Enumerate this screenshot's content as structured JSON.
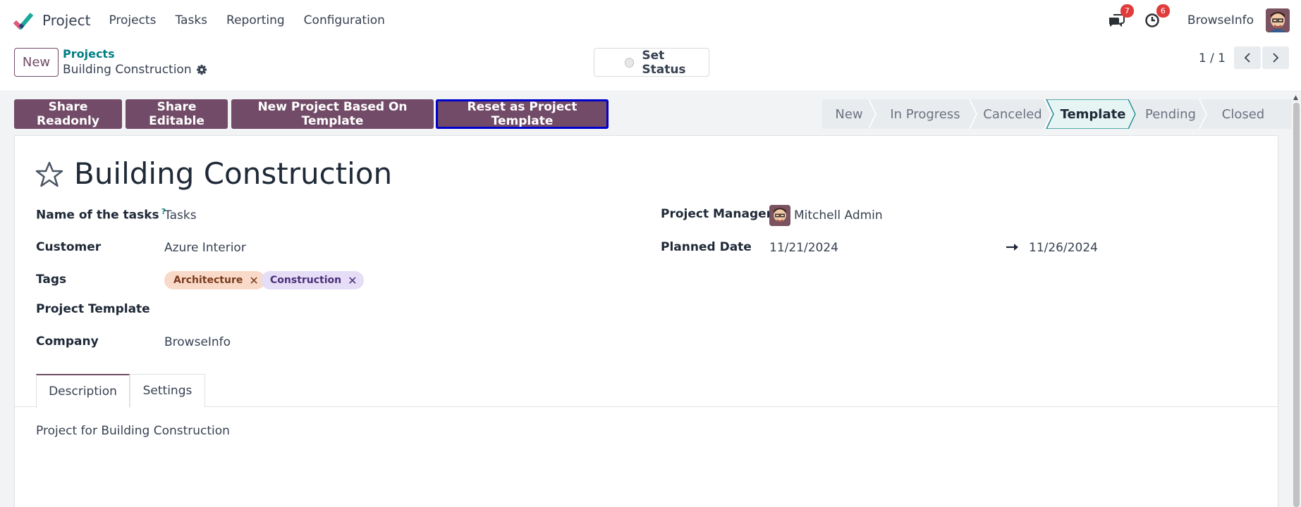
{
  "navbar": {
    "app_name": "Project",
    "menu": [
      "Projects",
      "Tasks",
      "Reporting",
      "Configuration"
    ],
    "messages_count": "7",
    "activities_count": "6",
    "company": "BrowseInfo"
  },
  "control_panel": {
    "new_label": "New",
    "breadcrumb_parent": "Projects",
    "breadcrumb_current": "Building Construction",
    "set_status_label": "Set Status",
    "pager": "1 / 1"
  },
  "actions": {
    "share_readonly": "Share Readonly",
    "share_editable": "Share Editable",
    "new_based_on_template": "New Project Based On Template",
    "reset_template": "Reset as Project Template"
  },
  "stages": [
    "New",
    "In Progress",
    "Canceled",
    "Template",
    "Pending",
    "Closed"
  ],
  "active_stage": "Template",
  "form": {
    "title": "Building Construction",
    "fields": {
      "tasks_label": "Name of the tasks",
      "tasks_help": "?",
      "tasks_value": "Tasks",
      "customer_label": "Customer",
      "customer_value": "Azure Interior",
      "tags_label": "Tags",
      "tags": [
        "Architecture",
        "Construction"
      ],
      "template_label": "Project Template",
      "company_label": "Company",
      "company_value": "BrowseInfo",
      "manager_label": "Project Manager",
      "manager_value": "Mitchell Admin",
      "planned_label": "Planned Date",
      "planned_start": "11/21/2024",
      "planned_end": "11/26/2024"
    },
    "tabs": [
      "Description",
      "Settings"
    ],
    "active_tab": "Description",
    "description": "Project for Building Construction"
  },
  "colors": {
    "primary": "#714b67",
    "link": "#017e84",
    "tag_architecture_bg": "#f9d9c8",
    "tag_construction_bg": "#e6ddf6",
    "badge": "#e03c3c"
  }
}
